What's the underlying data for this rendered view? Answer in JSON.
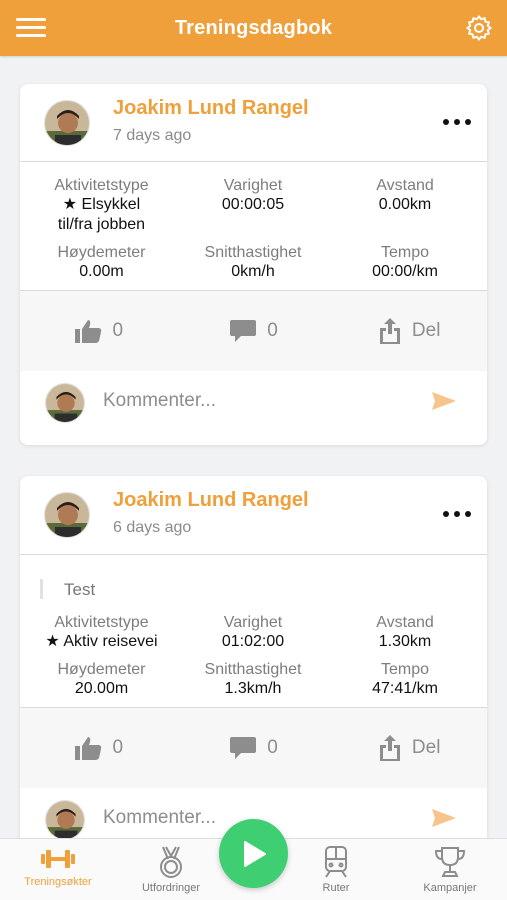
{
  "header": {
    "title": "Treningsdagbok",
    "menu_icon": "hamburger-menu-icon",
    "settings_icon": "gear-icon"
  },
  "colors": {
    "accent": "#f0a03a",
    "play": "#3fcf72",
    "text_muted": "#8a8a8a"
  },
  "posts": [
    {
      "user": "Joakim Lund Rangel",
      "time": "7 days ago",
      "note": "",
      "stats": [
        {
          "label": "Aktivitetstype",
          "value": "★ Elsykkel til/fra jobben"
        },
        {
          "label": "Varighet",
          "value": "00:00:05"
        },
        {
          "label": "Avstand",
          "value": "0.00km"
        },
        {
          "label": "Høydemeter",
          "value": "0.00m"
        },
        {
          "label": "Snitthastighet",
          "value": "0km/h"
        },
        {
          "label": "Tempo",
          "value": "00:00/km"
        }
      ],
      "likes": "0",
      "comments": "0",
      "share_label": "Del",
      "comment_placeholder": "Kommenter..."
    },
    {
      "user": "Joakim Lund Rangel",
      "time": "6 days ago",
      "note": "Test",
      "stats": [
        {
          "label": "Aktivitetstype",
          "value": "★ Aktiv reisevei"
        },
        {
          "label": "Varighet",
          "value": "01:02:00"
        },
        {
          "label": "Avstand",
          "value": "1.30km"
        },
        {
          "label": "Høydemeter",
          "value": "20.00m"
        },
        {
          "label": "Snitthastighet",
          "value": "1.3km/h"
        },
        {
          "label": "Tempo",
          "value": "47:41/km"
        }
      ],
      "likes": "0",
      "comments": "0",
      "share_label": "Del",
      "comment_placeholder": "Kommenter..."
    }
  ],
  "tabs": [
    {
      "label": "Treningsøkter",
      "icon": "dumbbell-icon",
      "active": true
    },
    {
      "label": "Utfordringer",
      "icon": "medal-icon",
      "active": false
    },
    {
      "label": "Ruter",
      "icon": "train-icon",
      "active": false
    },
    {
      "label": "Kampanjer",
      "icon": "trophy-icon",
      "active": false
    }
  ],
  "play_icon": "play-icon"
}
